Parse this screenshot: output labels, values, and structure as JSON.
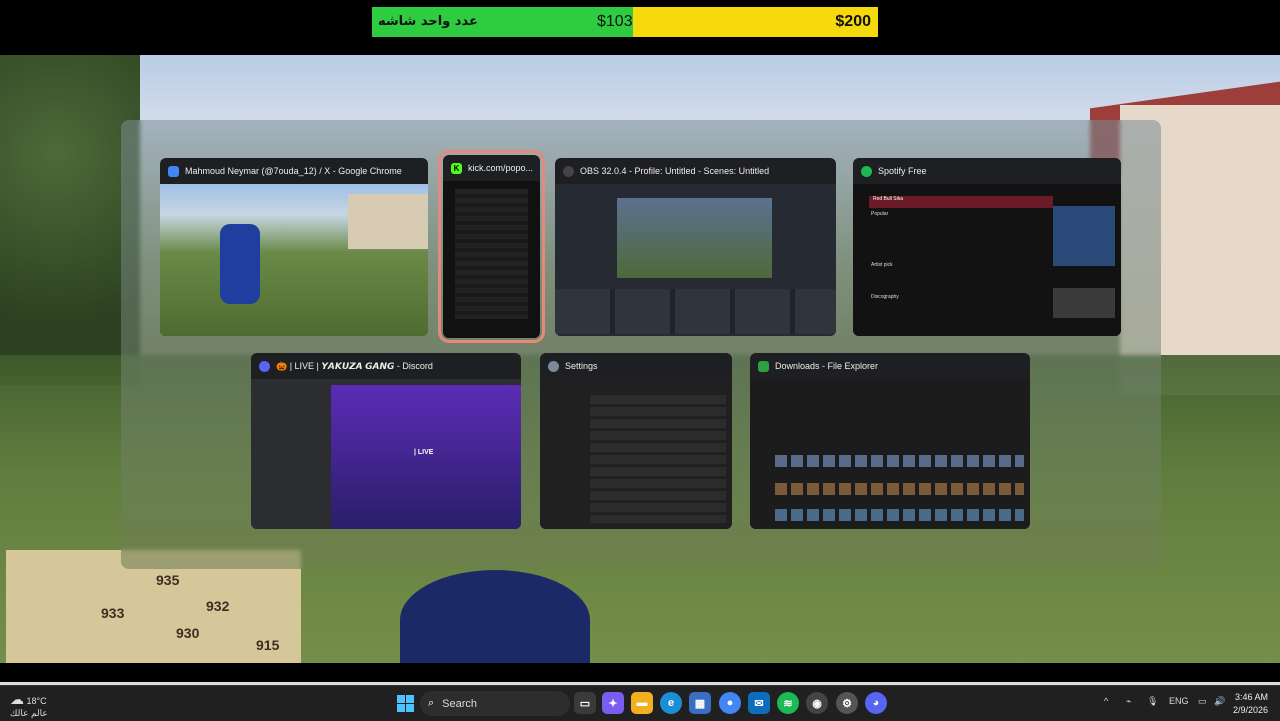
{
  "stream_goal": {
    "label": "عدد واحد شاشه",
    "current": "$103.00",
    "target": "$200",
    "progress": 0.515
  },
  "map_numbers": [
    "935",
    "933",
    "932",
    "930",
    "915"
  ],
  "task_switcher": {
    "windows": [
      {
        "title": "Mahmoud Neymar (@7ouda_12) / X - Google Chrome",
        "icon": "chrome-icon",
        "color": "#4285f4"
      },
      {
        "title": "kick.com/popo...",
        "icon": "kick-icon",
        "color": "#53fc18",
        "selected": true
      },
      {
        "title": "OBS 32.0.4 - Profile: Untitled - Scenes: Untitled",
        "icon": "obs-icon",
        "color": "#444444"
      },
      {
        "title": "Spotify Free",
        "icon": "spotify-icon",
        "color": "#1db954"
      },
      {
        "title": "🎃 | LIVE | 𝙔𝘼𝙆𝙐𝙕𝘼 𝙂𝘼𝙉𝙂 - Discord",
        "icon": "discord-icon",
        "color": "#5865f2"
      },
      {
        "title": "Settings",
        "icon": "settings-icon",
        "color": "#7a8a9a"
      },
      {
        "title": "Downloads - File Explorer",
        "icon": "folder-icon",
        "color": "#2ea043"
      }
    ],
    "spotify": {
      "artist": "Red Bull Sika",
      "section1": "Popular",
      "section2": "Artist pick",
      "section3": "Discography"
    },
    "discord": {
      "channel": "| LIVE"
    }
  },
  "taskbar": {
    "weather": {
      "temp": "18°C",
      "desc": "عالم عالك"
    },
    "search_label": "Search",
    "language": "ENG",
    "time": "3:46 AM",
    "date": "2/9/2026"
  }
}
